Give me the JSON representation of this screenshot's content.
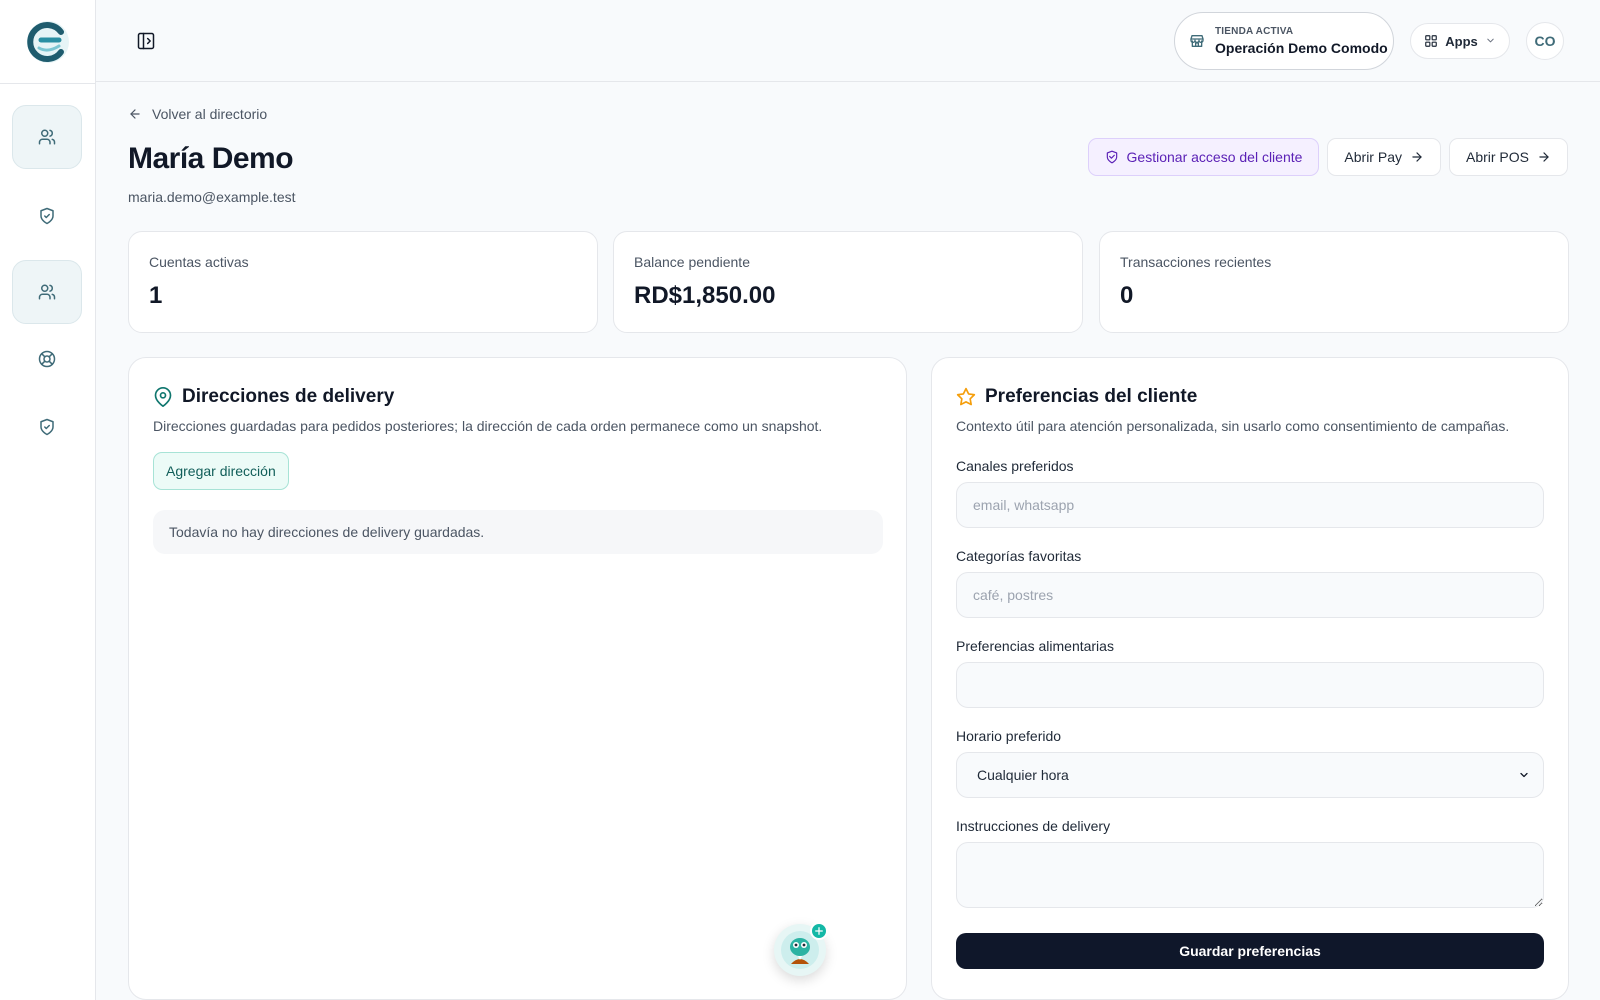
{
  "header": {
    "store_kicker": "TIENDA ACTIVA",
    "store_name": "Operación Demo Comodo",
    "apps_label": "Apps",
    "avatar_initials": "CO"
  },
  "sidebar": {
    "items": [
      {
        "icon": "users-icon",
        "active": true
      },
      {
        "icon": "shield-check-icon",
        "active": false
      },
      {
        "icon": "users-icon",
        "active": true
      },
      {
        "icon": "lifebuoy-icon",
        "active": false
      },
      {
        "icon": "shield-check-icon",
        "active": false
      }
    ]
  },
  "page": {
    "back_label": "Volver al directorio",
    "title": "María Demo",
    "email": "maria.demo@example.test"
  },
  "actions": {
    "manage_access": "Gestionar acceso del cliente",
    "open_pay": "Abrir Pay",
    "open_pos": "Abrir POS"
  },
  "stats": [
    {
      "label": "Cuentas activas",
      "value": "1"
    },
    {
      "label": "Balance pendiente",
      "value": "RD$1,850.00"
    },
    {
      "label": "Transacciones recientes",
      "value": "0"
    }
  ],
  "delivery": {
    "title": "Direcciones de delivery",
    "description": "Direcciones guardadas para pedidos posteriores; la dirección de cada orden permanece como un snapshot.",
    "add_label": "Agregar dirección",
    "empty_text": "Todavía no hay direcciones de delivery guardadas."
  },
  "preferences": {
    "title": "Preferencias del cliente",
    "description": "Contexto útil para atención personalizada, sin usarlo como consentimiento de campañas.",
    "channels_label": "Canales preferidos",
    "channels_placeholder": "email, whatsapp",
    "categories_label": "Categorías favoritas",
    "categories_placeholder": "café, postres",
    "dietary_label": "Preferencias alimentarias",
    "schedule_label": "Horario preferido",
    "schedule_value": "Cualquier hora",
    "instructions_label": "Instrucciones de delivery",
    "save_label": "Guardar preferencias"
  },
  "colors": {
    "accent": "#3f6b78",
    "primary_dark": "#0f172a",
    "purple": "#5b21b6",
    "teal": "#115e59",
    "star": "#f59e0b"
  }
}
